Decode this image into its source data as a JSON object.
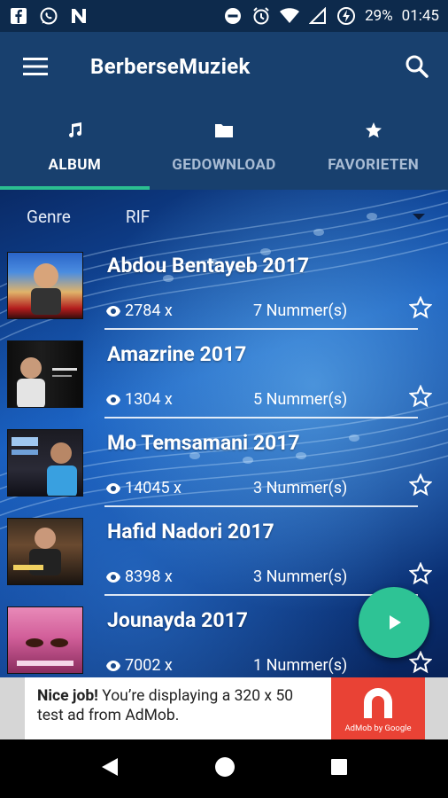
{
  "status_bar": {
    "left_icons": [
      "facebook-icon",
      "whatsapp-icon",
      "n-notification-icon"
    ],
    "right_icons": [
      "do-not-disturb-icon",
      "alarm-icon",
      "wifi-icon",
      "signal-icon",
      "battery-charging-icon"
    ],
    "battery": "29%",
    "time": "01:45"
  },
  "app_bar": {
    "title": "BerberseMuziek",
    "menu_icon": "hamburger-menu-icon",
    "search_icon": "search-icon"
  },
  "tabs": [
    {
      "label": "ALBUM",
      "icon": "music-note-icon",
      "active": true
    },
    {
      "label": "GEDOWNLOAD",
      "icon": "folder-icon",
      "active": false
    },
    {
      "label": "FAVORIETEN",
      "icon": "star-icon",
      "active": false
    }
  ],
  "filter": {
    "label": "Genre",
    "value": "RIF"
  },
  "albums": [
    {
      "title": "Abdou Bentayeb 2017",
      "views": "2784 x",
      "tracks": "7 Nummer(s)"
    },
    {
      "title": "Amazrine 2017",
      "views": "1304 x",
      "tracks": "5 Nummer(s)"
    },
    {
      "title": "Mo Temsamani 2017",
      "views": "14045 x",
      "tracks": "3 Nummer(s)"
    },
    {
      "title": "Hafid Nadori 2017",
      "views": "8398 x",
      "tracks": "3 Nummer(s)"
    },
    {
      "title": "Jounayda 2017",
      "views": "7002 x",
      "tracks": "1 Nummer(s)"
    }
  ],
  "fab": {
    "icon": "play-icon"
  },
  "ad": {
    "bold": "Nice job!",
    "text": " You’re displaying a 320 x 50 test ad from AdMob.",
    "logo_caption": "AdMob by Google"
  },
  "colors": {
    "status_bar": "#0d2a4c",
    "app_bar": "#18406e",
    "accent": "#2ec395",
    "ad_logo": "#e94235"
  }
}
